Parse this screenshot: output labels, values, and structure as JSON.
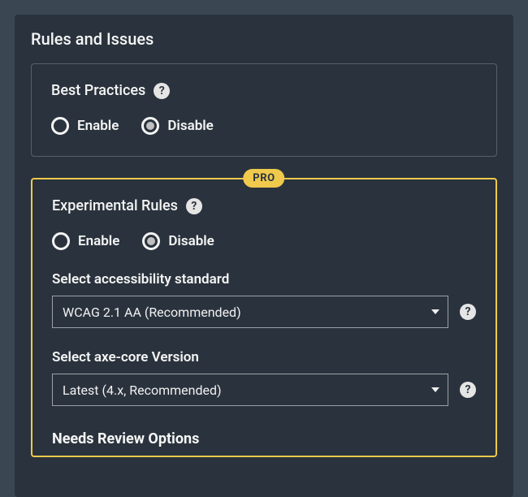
{
  "panel": {
    "title": "Rules and Issues"
  },
  "bestPractices": {
    "label": "Best Practices",
    "options": {
      "enable": "Enable",
      "disable": "Disable"
    },
    "selected": "disable"
  },
  "proBadge": "PRO",
  "experimentalRules": {
    "label": "Experimental Rules",
    "options": {
      "enable": "Enable",
      "disable": "Disable"
    },
    "selected": "disable"
  },
  "accessibilityStandard": {
    "label": "Select accessibility standard",
    "value": "WCAG 2.1 AA (Recommended)"
  },
  "axeCoreVersion": {
    "label": "Select axe-core Version",
    "value": "Latest (4.x, Recommended)"
  },
  "needsReview": {
    "heading": "Needs Review Options"
  },
  "helpGlyph": "?"
}
